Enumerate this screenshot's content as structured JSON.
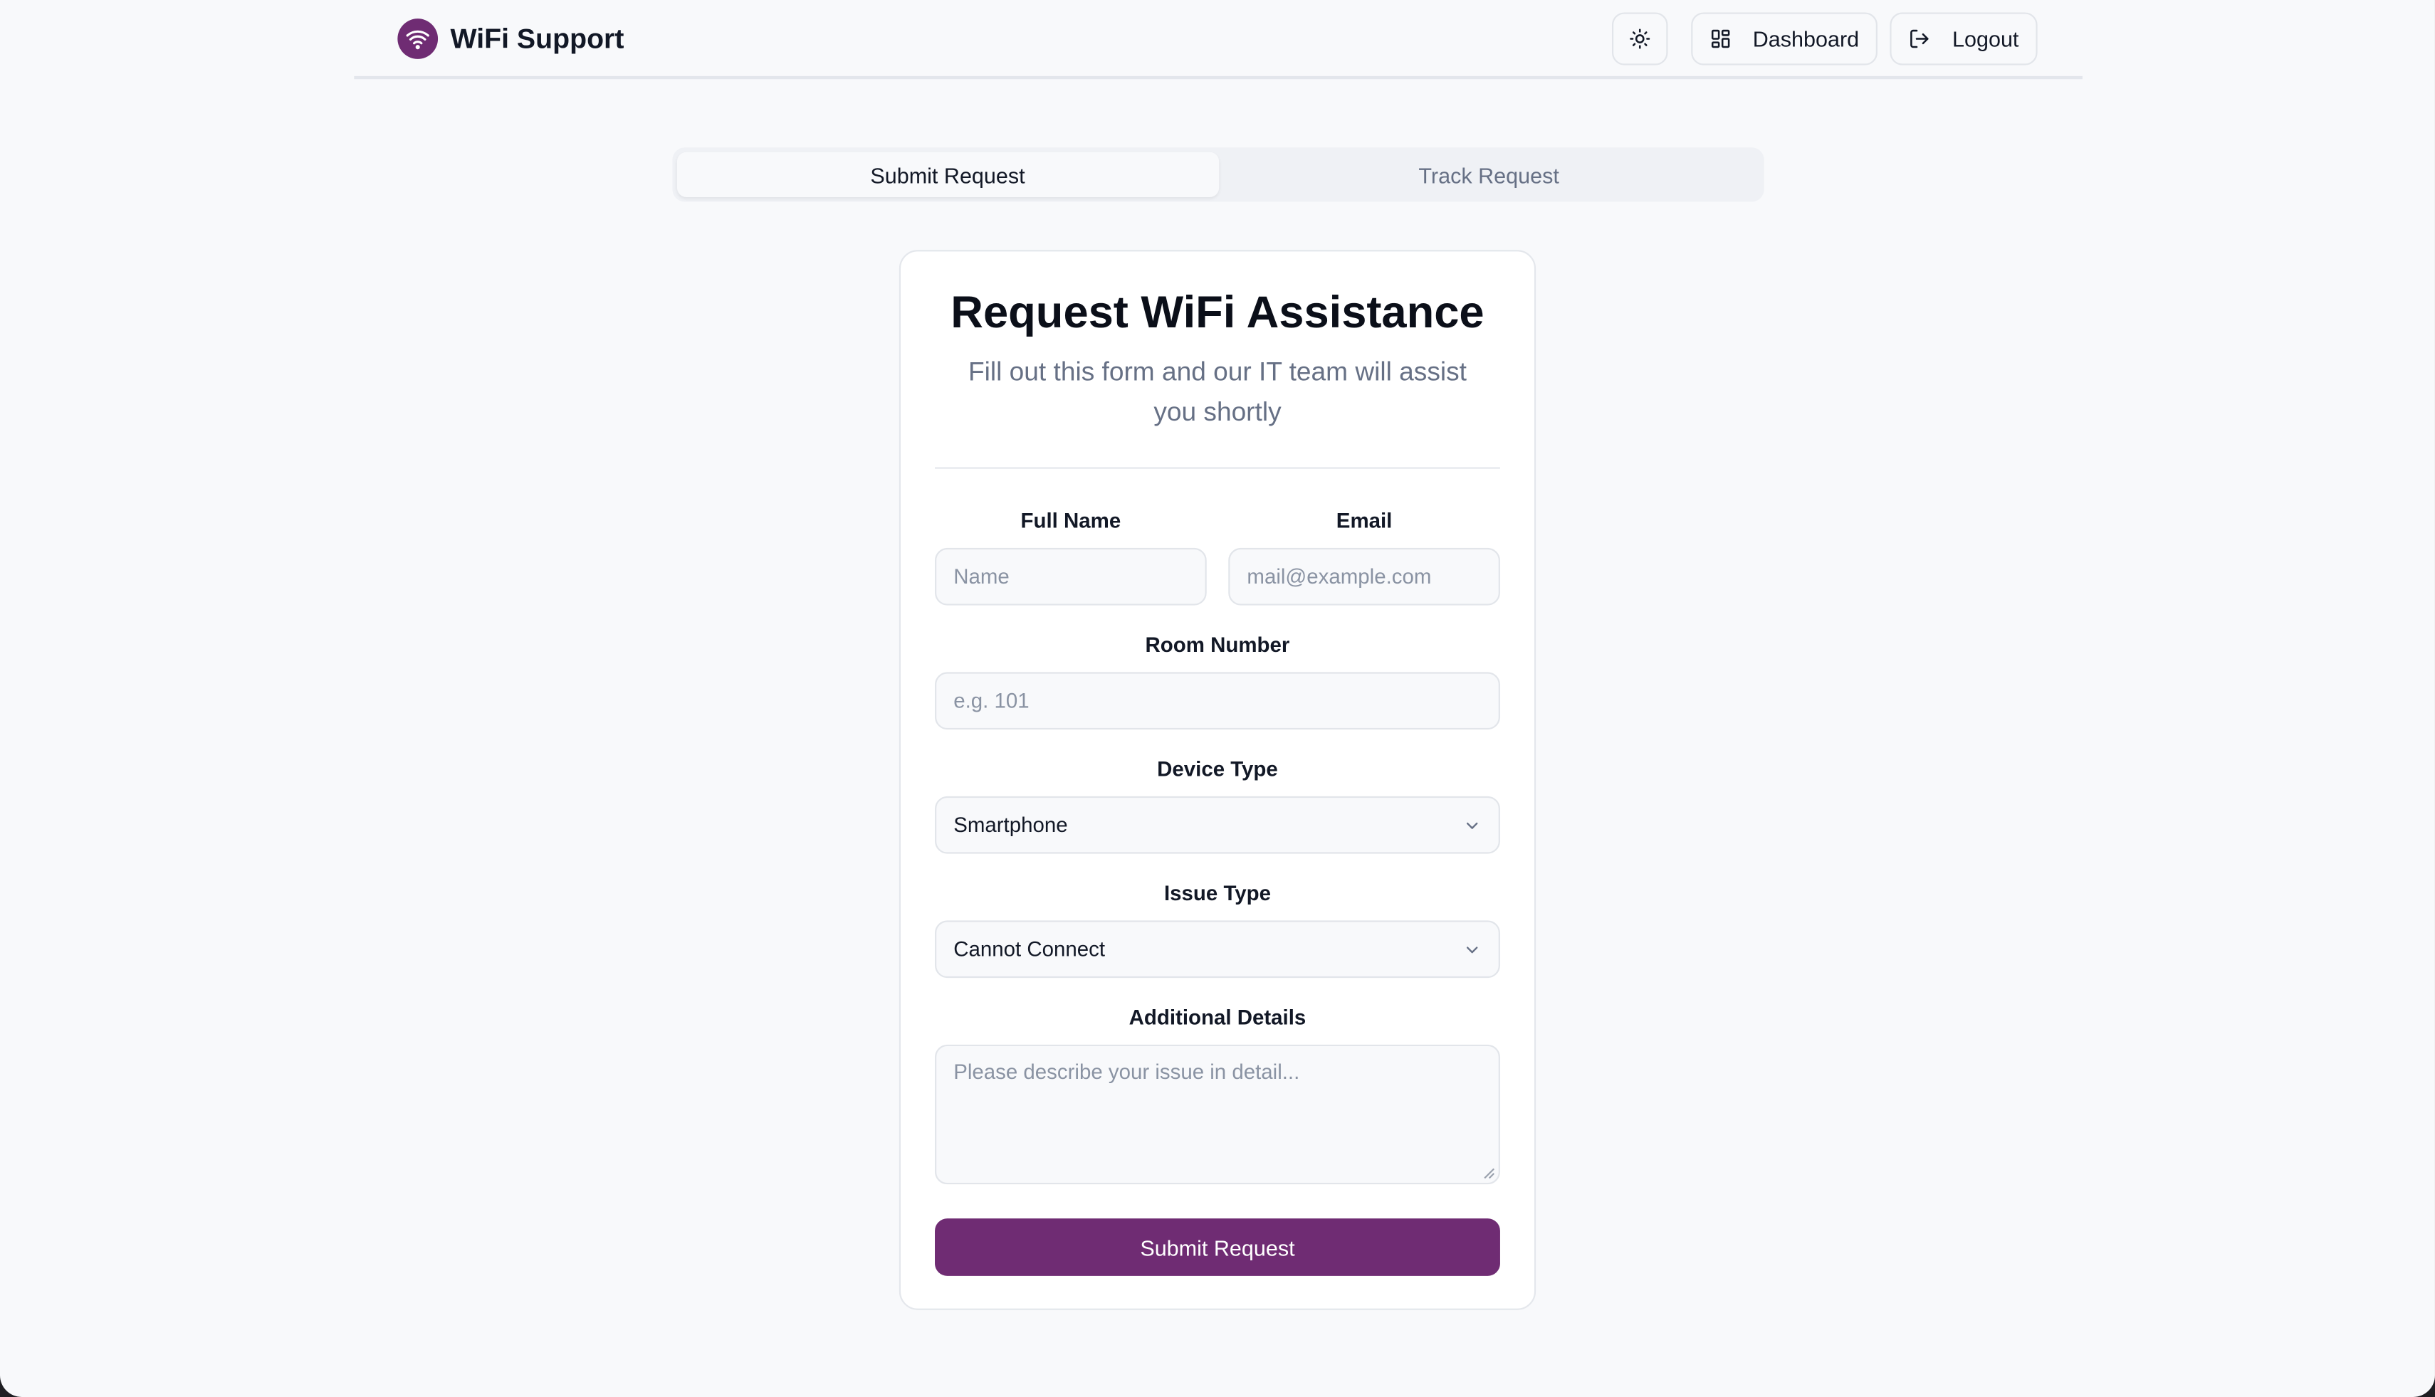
{
  "app": {
    "title": "WiFi Support",
    "accent": "#6f2c73"
  },
  "nav": {
    "theme_toggle_icon": "sun-icon",
    "dashboard_label": "Dashboard",
    "logout_label": "Logout"
  },
  "tabs": [
    {
      "label": "Submit Request",
      "active": true
    },
    {
      "label": "Track Request",
      "active": false
    }
  ],
  "form": {
    "title": "Request WiFi Assistance",
    "subtitle": "Fill out this form and our IT team will assist you shortly",
    "full_name": {
      "label": "Full Name",
      "placeholder": "Name",
      "value": ""
    },
    "email": {
      "label": "Email",
      "placeholder": "mail@example.com",
      "value": ""
    },
    "room_number": {
      "label": "Room Number",
      "placeholder": "e.g. 101",
      "value": ""
    },
    "device_type": {
      "label": "Device Type",
      "value": "Smartphone"
    },
    "issue_type": {
      "label": "Issue Type",
      "value": "Cannot Connect"
    },
    "details": {
      "label": "Additional Details",
      "placeholder": "Please describe your issue in detail...",
      "value": ""
    },
    "submit_label": "Submit Request"
  }
}
